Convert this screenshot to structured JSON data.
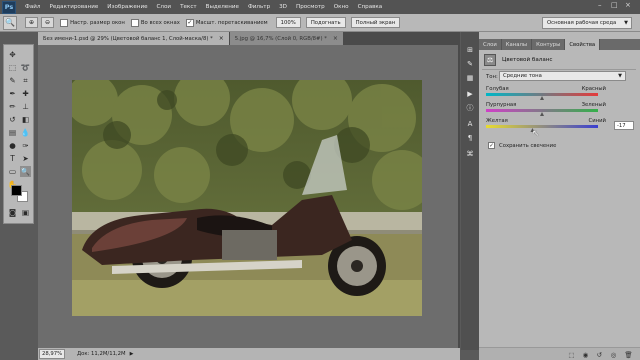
{
  "app": {
    "logo": "Ps"
  },
  "menu": [
    "Файл",
    "Редактирование",
    "Изображение",
    "Слои",
    "Текст",
    "Выделение",
    "Фильтр",
    "3D",
    "Просмотр",
    "Окно",
    "Справка"
  ],
  "options": {
    "resize_windows": "Настр. размер окон",
    "all_windows": "Во всех окнах",
    "scrubby_zoom": "Масшт. перетаскиванием",
    "zoom_100": "100%",
    "fit": "Подогнать",
    "full_screen": "Полный экран",
    "workspace": "Основная рабочая среда"
  },
  "tabs": [
    {
      "label": "Без имени-1.psd @ 29% (Цветовой баланс 1, Слой-маска/8) *"
    },
    {
      "label": "5.jpg @ 16,7% (Слой 0, RGB/8#) *"
    }
  ],
  "status": {
    "zoom": "28,97%",
    "doc": "Док: 11,2M/11,2M"
  },
  "panel": {
    "tabs": [
      "Слои",
      "Каналы",
      "Контуры",
      "Свойства"
    ],
    "active_tab": 3,
    "title": "Цветовой баланс",
    "tone_label": "Тон:",
    "tone_value": "Средние тона",
    "sliders": [
      {
        "left": "Голубая",
        "right": "Красный",
        "value": "",
        "level": 0.5,
        "from": "#00b7c7",
        "to": "#e43b3b"
      },
      {
        "left": "Пурпурная",
        "right": "Зеленый",
        "value": "",
        "level": 0.5,
        "from": "#d040c8",
        "to": "#34b04a"
      },
      {
        "left": "Желтая",
        "right": "Синий",
        "value": "-17",
        "level": 0.415,
        "from": "#e8dc30",
        "to": "#3a3fd0"
      }
    ],
    "preserve": "Сохранить свечение"
  },
  "colors": {
    "accent": "#1f3d5c"
  }
}
